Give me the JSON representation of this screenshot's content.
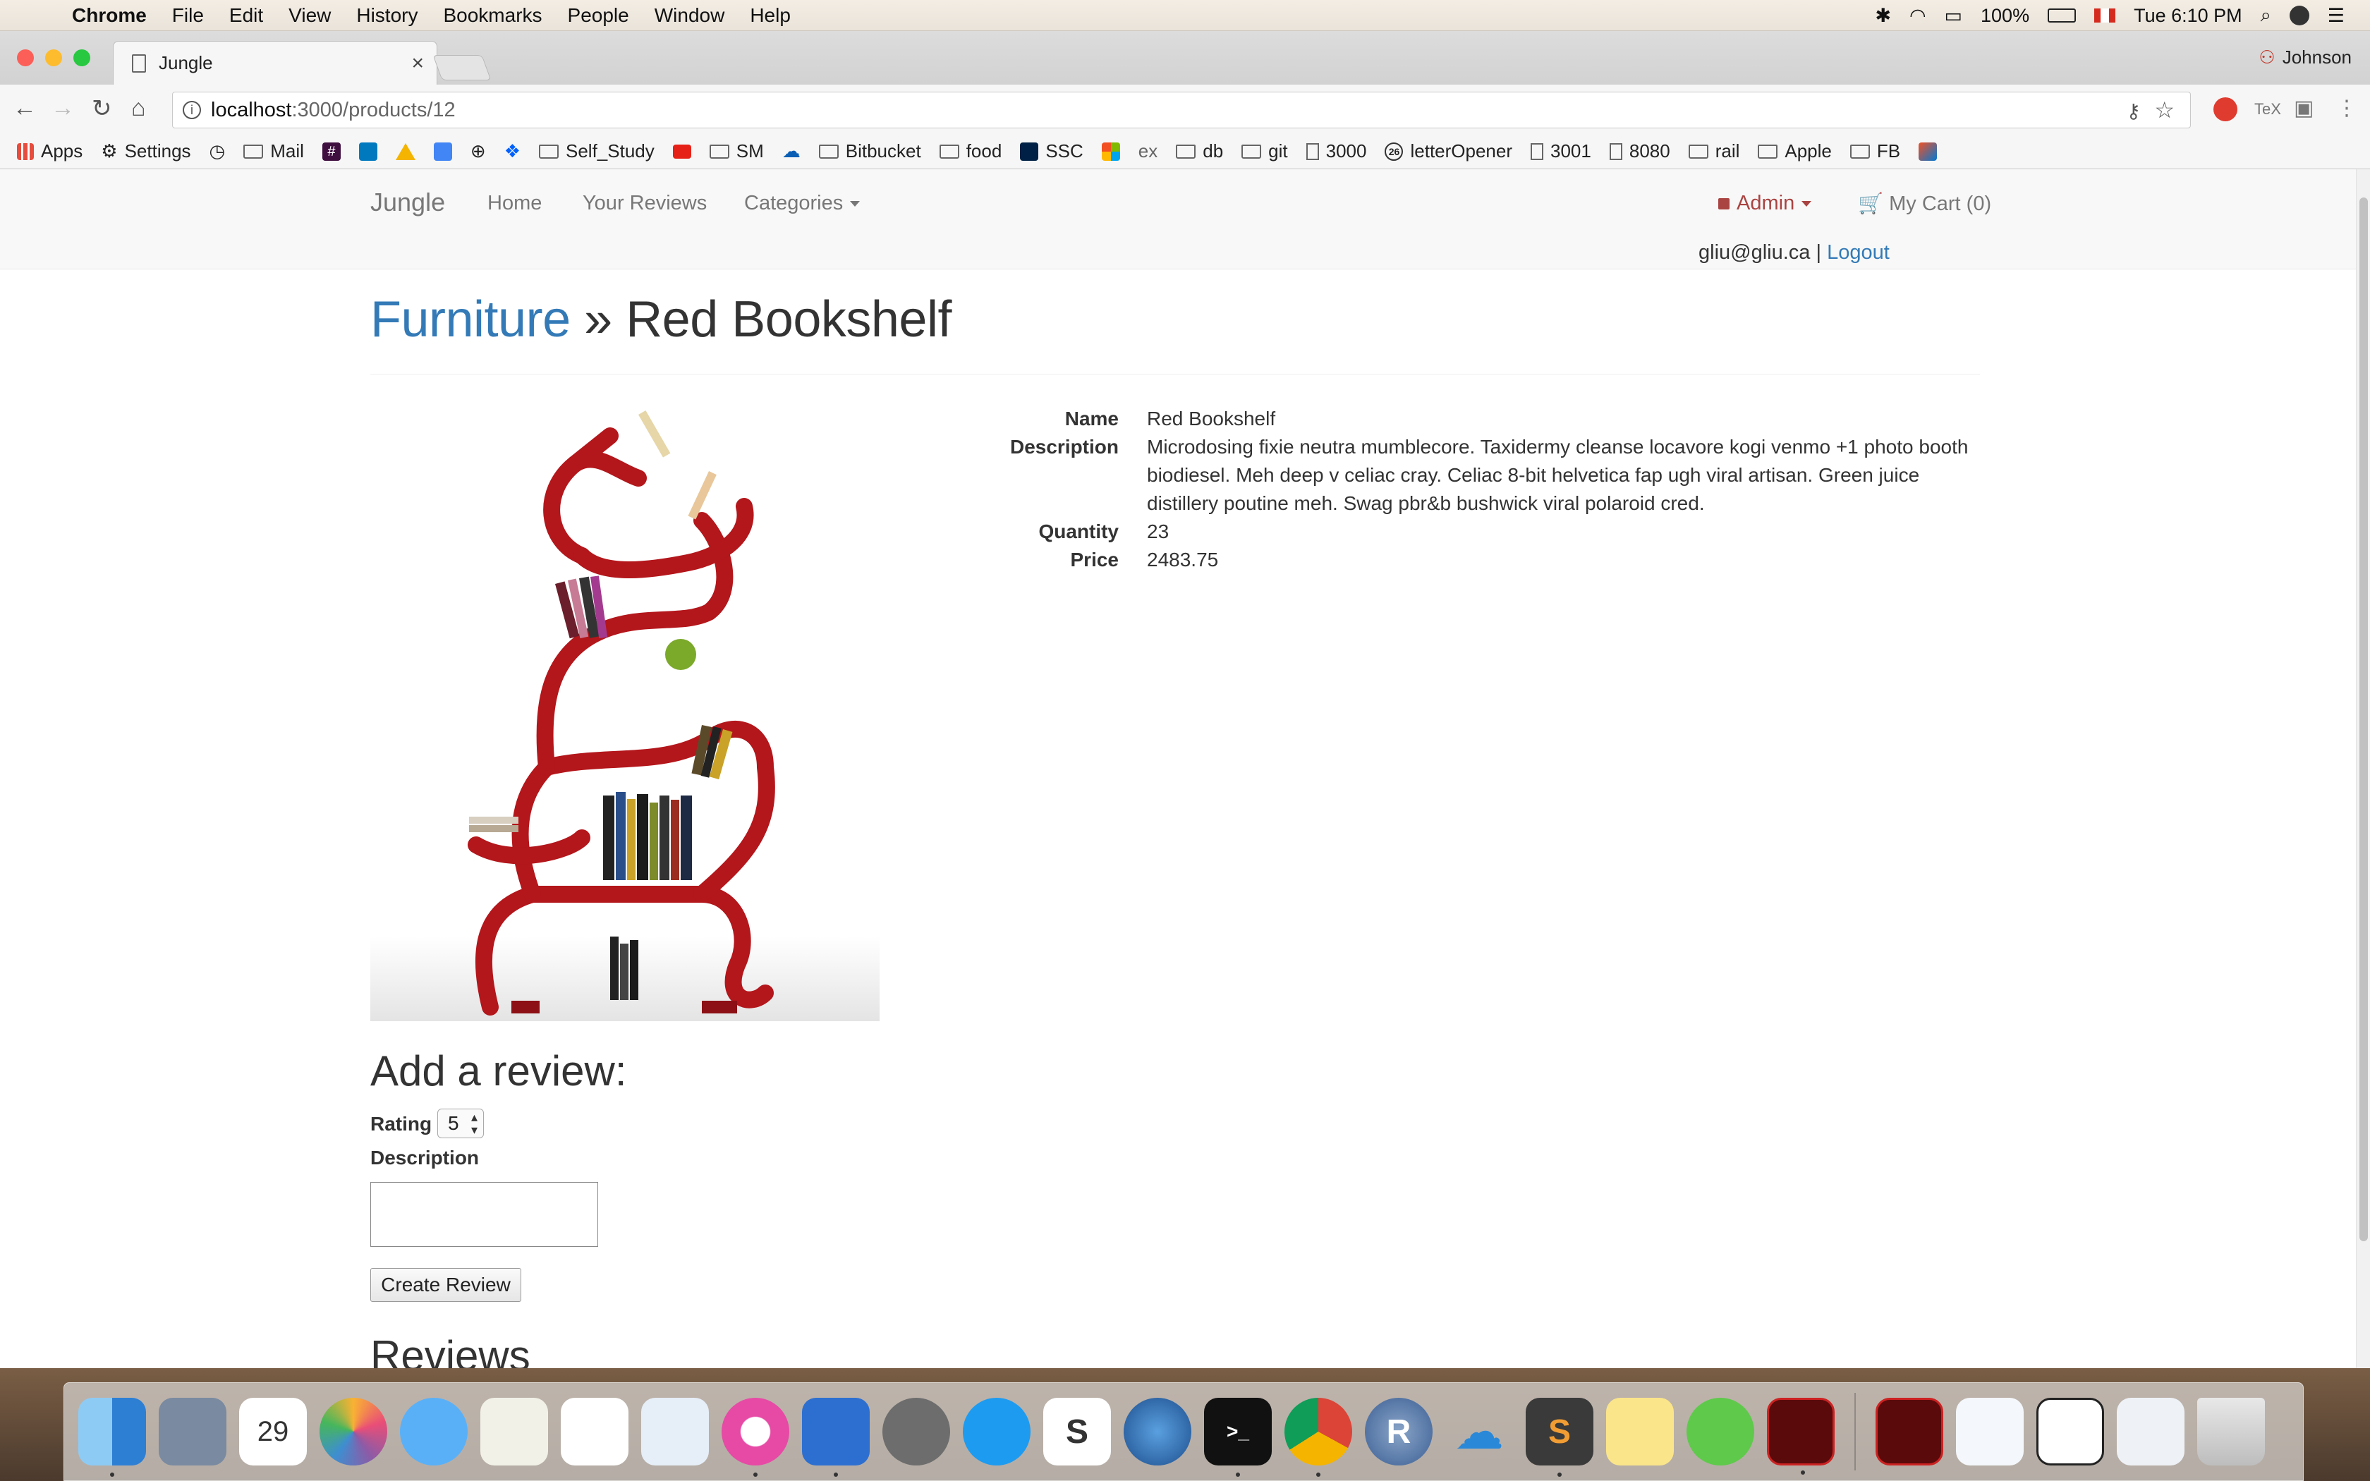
{
  "menubar": {
    "app_name": "Chrome",
    "items": [
      "File",
      "Edit",
      "View",
      "History",
      "Bookmarks",
      "People",
      "Window",
      "Help"
    ],
    "battery": "100%",
    "clock": "Tue 6:10 PM"
  },
  "browser": {
    "tab_title": "Jungle",
    "profile_name": "Johnson",
    "url_host": "localhost",
    "url_path": ":3000/products/12",
    "bookmarks": [
      "Apps",
      "Settings",
      "Mail",
      "Self_Study",
      "SM",
      "Bitbucket",
      "food",
      "SSC",
      "ex",
      "db",
      "git",
      "3000",
      "letterOpener",
      "3001",
      "8080",
      "rail",
      "Apple",
      "FB"
    ]
  },
  "site": {
    "brand": "Jungle",
    "nav": {
      "home": "Home",
      "reviews": "Your Reviews",
      "categories": "Categories"
    },
    "admin_label": "Admin",
    "cart_label": "My Cart (0)",
    "user_email": "gliu@gliu.ca",
    "separator": "|",
    "logout_label": "Logout"
  },
  "product": {
    "category": "Furniture",
    "breadcrumb_sep": "»",
    "name": "Red Bookshelf",
    "labels": {
      "name": "Name",
      "description": "Description",
      "quantity": "Quantity",
      "price": "Price"
    },
    "description": "Microdosing fixie neutra mumblecore. Taxidermy cleanse locavore kogi venmo +1 photo booth biodiesel. Meh deep v celiac cray. Celiac 8-bit helvetica fap ugh viral artisan. Green juice distillery poutine meh. Swag pbr&b bushwick viral polaroid cred.",
    "quantity": "23",
    "price": "2483.75"
  },
  "review_form": {
    "heading": "Add a review:",
    "rating_label": "Rating",
    "rating_value": "5",
    "description_label": "Description",
    "description_value": "",
    "submit_label": "Create Review"
  },
  "reviews": {
    "heading": "Reviews"
  },
  "colors": {
    "link": "#337ab7",
    "admin": "#a94442",
    "shelf_red": "#b3161b"
  }
}
